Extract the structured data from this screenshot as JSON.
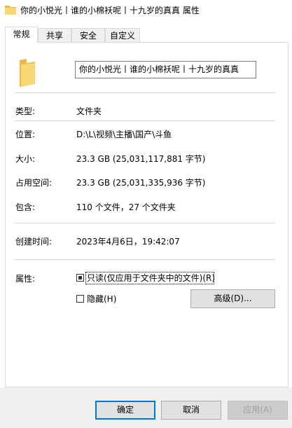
{
  "window": {
    "title": "你的小悦光丨谁的小棉袄呢丨十九岁的真真 属性"
  },
  "tabs": [
    {
      "label": "常规",
      "active": true
    },
    {
      "label": "共享",
      "active": false
    },
    {
      "label": "安全",
      "active": false
    },
    {
      "label": "自定义",
      "active": false
    }
  ],
  "general": {
    "name_value": "你的小悦光丨谁的小棉袄呢丨十九岁的真真",
    "type_label": "类型:",
    "type_value": "文件夹",
    "location_label": "位置:",
    "location_value": "D:\\L\\视频\\主播\\国产\\斗鱼",
    "size_label": "大小:",
    "size_value": "23.3 GB (25,031,117,881 字节)",
    "disk_size_label": "占用空间:",
    "disk_size_value": "23.3 GB (25,031,335,936 字节)",
    "contains_label": "包含:",
    "contains_value": "110 个文件，27 个文件夹",
    "created_label": "创建时间:",
    "created_value": "2023年4月6日，19:42:07",
    "attributes_label": "属性:",
    "readonly_label": "只读(仅应用于文件夹中的文件)(R)",
    "hidden_label": "隐藏(H)",
    "advanced_button": "高级(D)..."
  },
  "buttons": {
    "ok": "确定",
    "cancel": "取消",
    "apply": "应用(A)"
  },
  "colors": {
    "folder": "#f8d775",
    "accent": "#0078d7"
  }
}
